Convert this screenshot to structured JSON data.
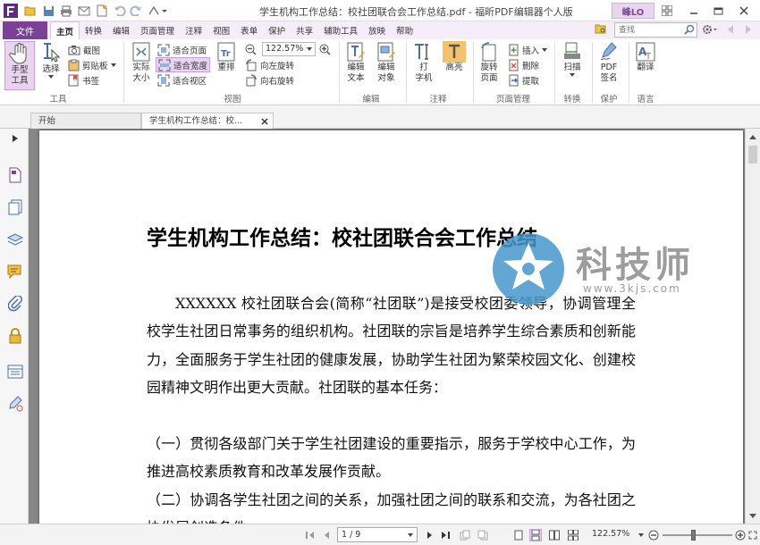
{
  "window": {
    "title": "学生机构工作总结：校社团联合会工作总结.pdf - 福昕PDF编辑器个人版",
    "user": "峰LO"
  },
  "menu": {
    "file": "文件",
    "items": [
      "主页",
      "转换",
      "编辑",
      "页面管理",
      "注释",
      "视图",
      "表单",
      "保护",
      "共享",
      "辅助工具",
      "放映",
      "帮助"
    ],
    "active": "主页"
  },
  "search": {
    "placeholder": "查找"
  },
  "ribbon": {
    "hand_tool": "手型\n工具",
    "select": "选择",
    "snapshot": "截图",
    "clipboard": "剪贴板",
    "bookmark": "书签",
    "actual_size": "实际\n大小",
    "fit_page": "适合页面",
    "fit_width": "适合宽度",
    "fit_visible": "适合视区",
    "reflow": "重排",
    "zoom_value": "122.57%",
    "rotate_left": "向左旋转",
    "rotate_right": "向右旋转",
    "edit_text": "编辑\n文本",
    "edit_object": "编辑\n对象",
    "typewriter": "打\n字机",
    "highlight": "高亮",
    "rotate_page": "旋转\n页面",
    "insert": "插入",
    "delete": "删除",
    "extract": "提取",
    "scan": "扫描",
    "pdf_sign": "PDF\n签名",
    "translate": "翻译",
    "groups": {
      "tools": "工具",
      "view": "视图",
      "edit": "编辑",
      "comment": "注释",
      "page_mgmt": "页面管理",
      "convert": "转换",
      "protect": "保护",
      "language": "语言"
    }
  },
  "tabs": {
    "start": "开始",
    "document": "学生机构工作总结：校..."
  },
  "document": {
    "title": "学生机构工作总结：校社团联合会工作总结",
    "paragraphs": [
      "XXXXXX 校社团联合会(简称“社团联”)是接受校团委领导，协调管理全校学生社团日常事务的组织机构。社团联的宗旨是培养学生综合素质和创新能力，全面服务于学生社团的健康发展，协助学生社团为繁荣校园文化、创建校园精神文明作出更大贡献。社团联的基本任务：",
      "（一）贯彻各级部门关于学生社团建设的重要指示，服务于学校中心工作，为推进高校素质教育和改革发展作贡献。",
      "（二）协调各学生社团之间的关系，加强社团之间的联系和交流，为各社团之协发展创造条件"
    ]
  },
  "status": {
    "page": "1 / 9",
    "zoom": "122.57%"
  },
  "watermark": {
    "name": "科技师",
    "url": "www.3kjs.com"
  },
  "colors": {
    "accent": "#7b4197",
    "active_bg": "#e8d3f1"
  }
}
